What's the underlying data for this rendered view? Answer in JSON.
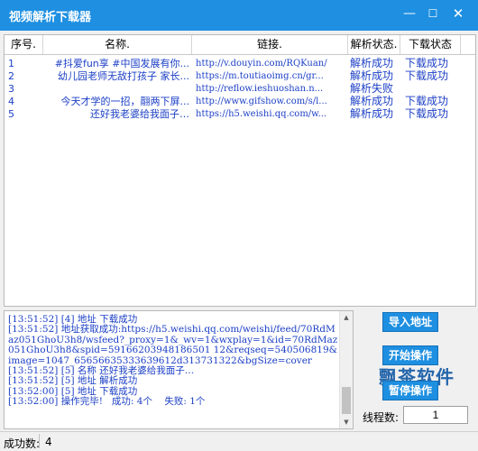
{
  "window": {
    "title": "视频解析下载器",
    "min_icon": "—",
    "max_icon": "☐",
    "close_icon": "✕"
  },
  "table": {
    "headers": [
      "序号.",
      "名称.",
      "链接.",
      "解析状态.",
      "下载状态"
    ],
    "rows": [
      {
        "index": "1",
        "name": "#抖爱fun享 #中国发展有你...",
        "link": "http://v.douyin.com/RQKuan/",
        "parse": "解析成功",
        "download": "下载成功"
      },
      {
        "index": "2",
        "name": "幼儿园老师无敌打孩子 家长...",
        "link": "https://m.toutiaoimg.cn/gr...",
        "parse": "解析成功",
        "download": "下载成功"
      },
      {
        "index": "3",
        "name": "",
        "link": "http://reflow.ieshuoshan.n...",
        "parse": "解析失败",
        "download": ""
      },
      {
        "index": "4",
        "name": "今天才学的一招，翮两下屏...",
        "link": "http://www.gifshow.com/s/l...",
        "parse": "解析成功",
        "download": "下载成功"
      },
      {
        "index": "5",
        "name": "还好我老婆给我面子…",
        "link": "https://h5.weishi.qq.com/w...",
        "parse": "解析成功",
        "download": "下载成功"
      }
    ]
  },
  "log": {
    "text": "[13:51:52] [4] 地址 下载成功\n[13:51:52] 地址获取成功:https://h5.weishi.qq.com/weishi/feed/70RdMaz051GhoU3h8/wsfeed?_proxy=1&_wv=1&wxplay=1&id=70RdMaz051GhoU3h8&spid=59166203948186501 12&reqseq=540506819&image=1047_65656635333639612d313731322&bgSize=cover\n[13:51:52] [5] 名称 还好我老婆给我面子…\n[13:51:52] [5] 地址 解析成功\n[13:52:00] [5] 地址 下载成功\n[13:52:00] 操作完毕!   成功: 4个    失败: 1个"
  },
  "buttons": {
    "import": "导入地址",
    "start": "开始操作",
    "pause": "暂停操作"
  },
  "watermark": "飘茶软件",
  "threads": {
    "label": "线程数:",
    "value": "1"
  },
  "status": {
    "label": "成功数:",
    "value": "4"
  },
  "icons": {
    "scroll_up": "▲",
    "scroll_down": "▼"
  },
  "colors": {
    "accent": "#1e8fe1",
    "row_text": "#1b3fc6"
  }
}
